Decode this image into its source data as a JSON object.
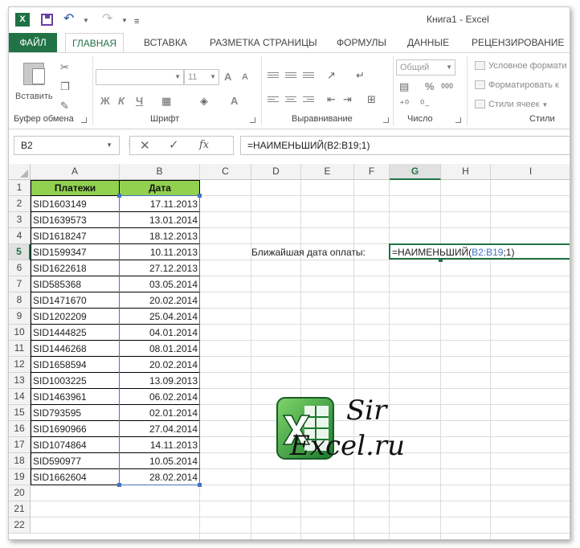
{
  "titlebar": {
    "app_icon": "excel-icon",
    "app_icon_letter": "X",
    "title": "Книга1 - Excel"
  },
  "tabs": {
    "file": "ФАЙЛ",
    "items": [
      "ГЛАВНАЯ",
      "ВСТАВКА",
      "РАЗМЕТКА СТРАНИЦЫ",
      "ФОРМУЛЫ",
      "ДАННЫЕ",
      "РЕЦЕНЗИРОВАНИЕ"
    ],
    "active": "ГЛАВНАЯ"
  },
  "ribbon": {
    "clipboard": {
      "paste_label": "Вставить",
      "group_label": "Буфер обмена"
    },
    "font": {
      "size_value": "11",
      "group_label": "Шрифт",
      "bold": "Ж",
      "italic": "К",
      "underline": "Ч",
      "grow": "A",
      "shrink": "A"
    },
    "alignment": {
      "group_label": "Выравнивание"
    },
    "number": {
      "format_value": "Общий",
      "percent": "%",
      "thousands": "000",
      "group_label": "Число"
    },
    "styles": {
      "conditional": "Условное формати",
      "format_table": "Форматировать к",
      "cell_styles": "Стили ячеек",
      "group_label": "Стили"
    }
  },
  "formula_bar": {
    "name_box": "B2",
    "fx": "fx",
    "formula": "=НАИМЕНЬШИЙ(B2:B19;1)"
  },
  "grid": {
    "columns": [
      "A",
      "B",
      "C",
      "D",
      "E",
      "F",
      "G",
      "H",
      "I"
    ],
    "selected_column": "G",
    "selected_row": 5,
    "rows": [
      1,
      2,
      3,
      4,
      5,
      6,
      7,
      8,
      9,
      10,
      11,
      12,
      13,
      14,
      15,
      16,
      17,
      18,
      19,
      20,
      21,
      22
    ],
    "table": {
      "headers": [
        "Платежи",
        "Дата"
      ],
      "rows": [
        [
          "SID1603149",
          "17.11.2013"
        ],
        [
          "SID1639573",
          "13.01.2014"
        ],
        [
          "SID1618247",
          "18.12.2013"
        ],
        [
          "SID1599347",
          "10.11.2013"
        ],
        [
          "SID1622618",
          "27.12.2013"
        ],
        [
          "SID585368",
          "03.05.2014"
        ],
        [
          "SID1471670",
          "20.02.2014"
        ],
        [
          "SID1202209",
          "25.04.2014"
        ],
        [
          "SID1444825",
          "04.01.2014"
        ],
        [
          "SID1446268",
          "08.01.2014"
        ],
        [
          "SID1658594",
          "20.02.2014"
        ],
        [
          "SID1003225",
          "13.09.2013"
        ],
        [
          "SID1463961",
          "06.02.2014"
        ],
        [
          "SID793595",
          "02.01.2014"
        ],
        [
          "SID1690966",
          "27.04.2014"
        ],
        [
          "SID1074864",
          "14.11.2013"
        ],
        [
          "SID590977",
          "10.05.2014"
        ],
        [
          "SID1662604",
          "28.02.2014"
        ]
      ]
    },
    "label_text": "Ближайшая дата оплаты:",
    "edit": {
      "prefix": "=НАИМЕНЬШИЙ(",
      "ref": "B2:B19",
      "suffix": ";1)"
    },
    "colors": {
      "header_fill": "#92d050",
      "accent": "#217346",
      "range": "#4472c4"
    }
  },
  "watermark": {
    "line1": "Sir",
    "line2": "Excel.ru"
  }
}
